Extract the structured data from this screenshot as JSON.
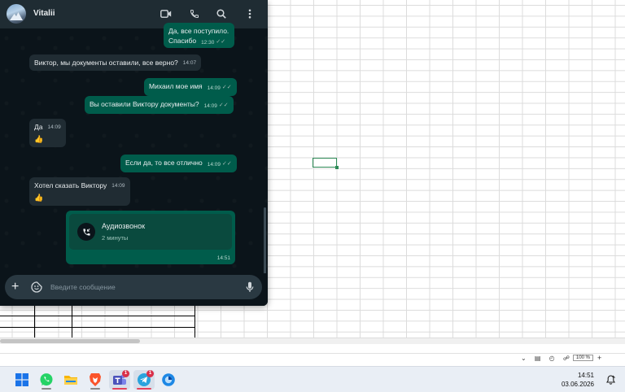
{
  "chat": {
    "contact_name": "Vitalii",
    "messages": [
      {
        "dir": "out",
        "text": "Да, все поступило. Спасибо",
        "time": "12:30",
        "ticks": "✓✓"
      },
      {
        "dir": "in",
        "text": "Виктор, мы документы оставили, все верно?",
        "time": "14:07"
      },
      {
        "dir": "out",
        "text": "Михаил мое имя",
        "time": "14:09",
        "ticks": "✓✓"
      },
      {
        "dir": "out",
        "text": "Вы оставили Виктору документы?",
        "time": "14:09",
        "ticks": "✓✓"
      },
      {
        "dir": "in",
        "text": "Да",
        "time": "14:09",
        "reaction": "👍"
      },
      {
        "dir": "out",
        "text": "Если да, то все отлично",
        "time": "14:09",
        "ticks": "✓✓"
      },
      {
        "dir": "in",
        "text": "Хотел сказать Виктору",
        "time": "14:09",
        "reaction": "👍"
      }
    ],
    "call": {
      "title": "Аудиозвонок",
      "duration": "2 минуты",
      "time": "14:51"
    },
    "composer_placeholder": "Введите сообщение"
  },
  "spreadsheet": {
    "zoom": "100 %"
  },
  "taskbar": {
    "apps": [
      {
        "name": "windows-start",
        "icon": "windows-icon"
      },
      {
        "name": "whatsapp",
        "icon": "whatsapp-icon"
      },
      {
        "name": "file-explorer",
        "icon": "folder-icon"
      },
      {
        "name": "brave",
        "icon": "brave-icon"
      },
      {
        "name": "teams",
        "icon": "teams-icon",
        "badge": "1"
      },
      {
        "name": "telegram",
        "icon": "telegram-icon",
        "badge": "1"
      },
      {
        "name": "browser",
        "icon": "globe-icon"
      }
    ],
    "time": "14:51",
    "date": "03.06.2026"
  },
  "colors": {
    "incoming": "#202c33",
    "outgoing": "#005c4b",
    "background": "#0b141a",
    "accent": "#2e8b57"
  }
}
